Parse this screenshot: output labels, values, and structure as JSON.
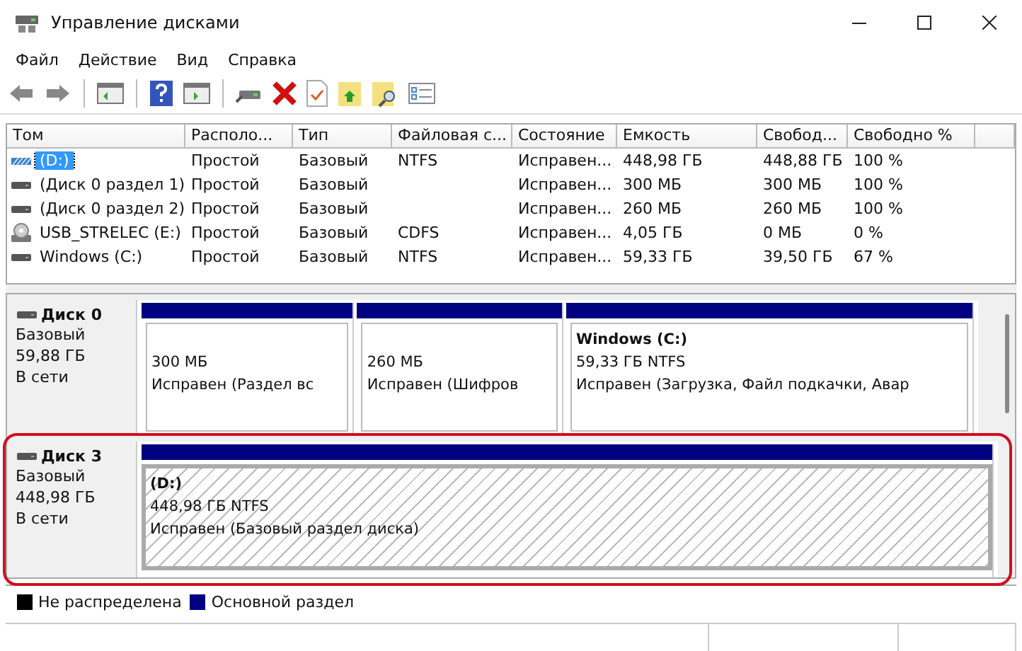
{
  "window": {
    "title": "Управление дисками"
  },
  "menu": [
    "Файл",
    "Действие",
    "Вид",
    "Справка"
  ],
  "table": {
    "columns": [
      "Том",
      "Располо...",
      "Тип",
      "Файловая с...",
      "Состояние",
      "Емкость",
      "Свобод...",
      "Свободно %"
    ],
    "rows": [
      {
        "kind": "hatched",
        "selected": true,
        "cells": [
          "(D:)",
          "Простой",
          "Базовый",
          "NTFS",
          "Исправен...",
          "448,98 ГБ",
          "448,88 ГБ",
          "100 %"
        ]
      },
      {
        "kind": "disk",
        "selected": false,
        "cells": [
          "(Диск 0 раздел 1)",
          "Простой",
          "Базовый",
          "",
          "Исправен...",
          "300 МБ",
          "300 МБ",
          "100 %"
        ]
      },
      {
        "kind": "disk",
        "selected": false,
        "cells": [
          "(Диск 0 раздел 2)",
          "Простой",
          "Базовый",
          "",
          "Исправен...",
          "260 МБ",
          "260 МБ",
          "100 %"
        ]
      },
      {
        "kind": "cd",
        "selected": false,
        "cells": [
          "USB_STRELEC (E:)",
          "Простой",
          "Базовый",
          "CDFS",
          "Исправен...",
          "4,05 ГБ",
          "0 МБ",
          "0 %"
        ]
      },
      {
        "kind": "disk",
        "selected": false,
        "cells": [
          "Windows (C:)",
          "Простой",
          "Базовый",
          "NTFS",
          "Исправен...",
          "59,33 ГБ",
          "39,50 ГБ",
          "67 %"
        ]
      }
    ]
  },
  "disks": [
    {
      "name": "Диск 0",
      "type": "Базовый",
      "size": "59,88 ГБ",
      "status": "В сети",
      "highlighted": false,
      "partitions": [
        {
          "size": "300 МБ",
          "status": "Исправен (Раздел вс",
          "selected": false
        },
        {
          "size": "260 МБ",
          "status": "Исправен (Шифров",
          "selected": false
        },
        {
          "title": "Windows  (C:)",
          "size": "59,33 ГБ NTFS",
          "status": "Исправен (Загрузка, Файл подкачки, Авар",
          "selected": false
        }
      ]
    },
    {
      "name": "Диск 3",
      "type": "Базовый",
      "size": "448,98 ГБ",
      "status": "В сети",
      "highlighted": true,
      "partitions": [
        {
          "title": "(D:)",
          "size": "448,98 ГБ NTFS",
          "status": "Исправен (Базовый раздел диска)",
          "selected": true
        }
      ]
    }
  ],
  "legend": [
    {
      "label": "Не распределена",
      "color": "#000000"
    },
    {
      "label": "Основной раздел",
      "color": "#000080"
    }
  ]
}
